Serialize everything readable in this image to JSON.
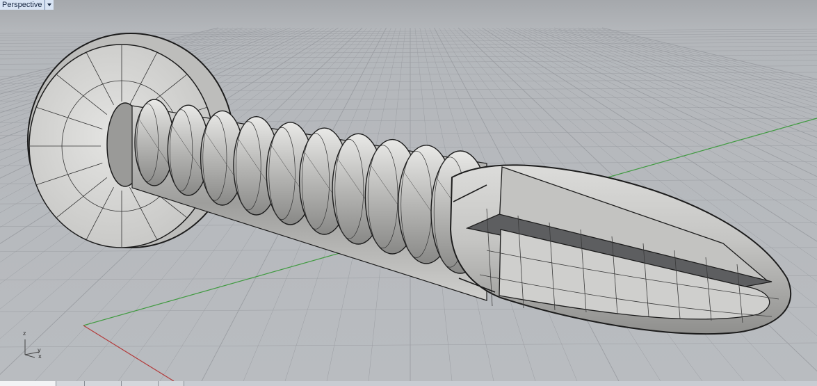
{
  "viewport": {
    "title": "Perspective",
    "axis_labels": {
      "z": "z",
      "y": "y",
      "x": "x"
    }
  },
  "tabs": [
    "",
    "",
    "",
    "",
    ""
  ]
}
